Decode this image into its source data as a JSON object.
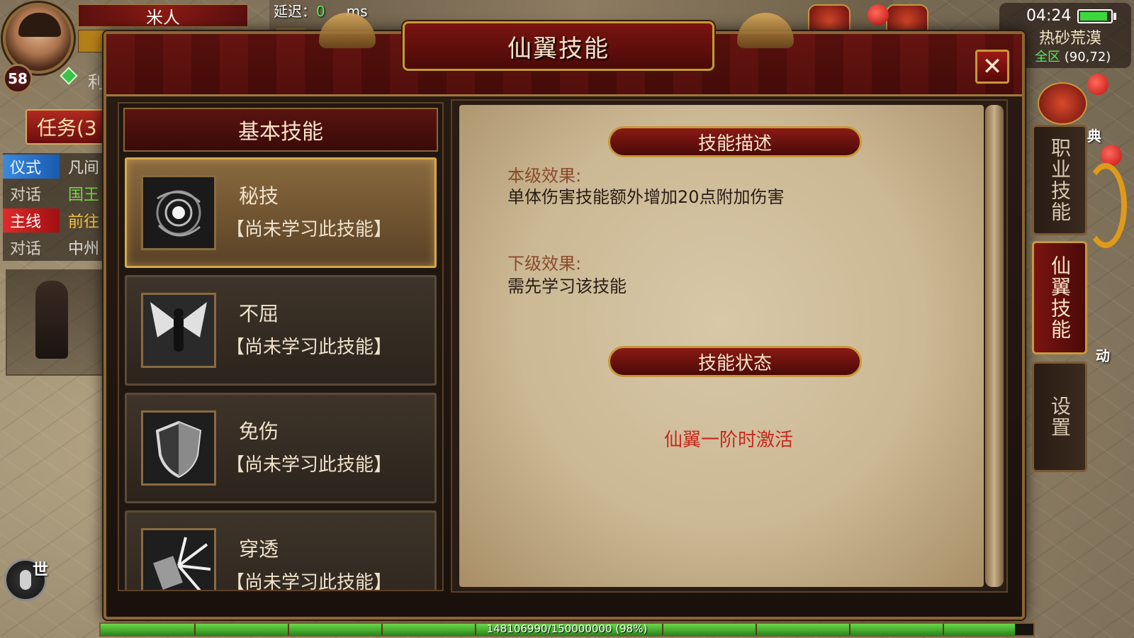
{
  "hud": {
    "player_name": "米人",
    "level": "58",
    "name_fragment": "利",
    "latency_label": "延迟：",
    "latency_value": "0",
    "latency_unit": "ms",
    "clock": "04:24",
    "battery_percent": 0.9,
    "map_name": "热砂荒漠",
    "map_zone": "全区",
    "map_coords": "(90,72)",
    "world_channel": "世",
    "deco_labels": {
      "dian": "典",
      "dong": "动"
    }
  },
  "quests": {
    "button_label": "任务(3",
    "rows": [
      {
        "tag": "仪式",
        "text": "凡间",
        "style": "blue",
        "text_style": "white"
      },
      {
        "tag": "对话",
        "text": "国王",
        "style": "plain",
        "text_style": "green"
      },
      {
        "tag": "主线",
        "text": "前往",
        "style": "red",
        "text_style": "gold"
      },
      {
        "tag": "对话",
        "text": "中州",
        "style": "plain",
        "text_style": "white"
      }
    ]
  },
  "dialog": {
    "title": "仙翼技能",
    "close_label": "✕",
    "left_panel": {
      "header": "基本技能",
      "skills": [
        {
          "name": "秘技",
          "status": "【尚未学习此技能】",
          "icon": "vortex-icon",
          "selected": true
        },
        {
          "name": "不屈",
          "status": "【尚未学习此技能】",
          "icon": "winged-warrior-icon",
          "selected": false
        },
        {
          "name": "免伤",
          "status": "【尚未学习此技能】",
          "icon": "shield-icon",
          "selected": false
        },
        {
          "name": "穿透",
          "status": "【尚未学习此技能】",
          "icon": "burst-icon",
          "selected": false
        }
      ]
    },
    "right_panel": {
      "desc_header": "技能描述",
      "current_label": "本级效果:",
      "current_text": "单体伤害技能额外增加20点附加伤害",
      "next_label": "下级效果:",
      "next_text": "需先学习该技能",
      "status_header": "技能状态",
      "status_text": "仙翼一阶时激活"
    }
  },
  "side_tabs": [
    {
      "label": "职业技能",
      "active": false
    },
    {
      "label": "仙翼技能",
      "active": true
    },
    {
      "label": "设置",
      "active": false
    }
  ],
  "exp": {
    "text": "148106990/150000000 (98%)",
    "fraction": 0.98
  },
  "colors": {
    "accent_gold": "#c8983a",
    "banner_red": "#8a1a14",
    "status_red": "#c8281e",
    "exp_green": "#3a9a2a"
  }
}
